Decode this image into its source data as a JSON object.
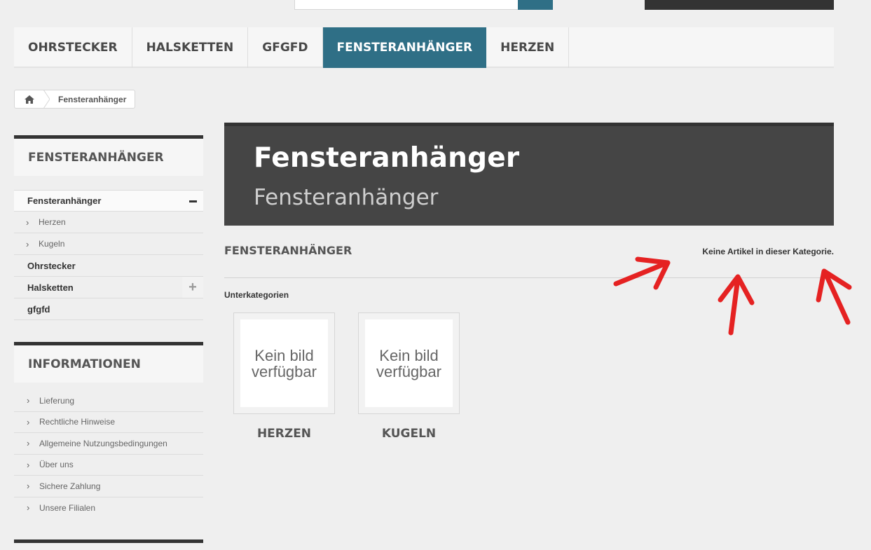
{
  "menu": {
    "items": [
      {
        "label": "OHRSTECKER"
      },
      {
        "label": "HALSKETTEN"
      },
      {
        "label": "GFGFD"
      },
      {
        "label": "FENSTERANHÄNGER"
      },
      {
        "label": "HERZEN"
      }
    ],
    "active_index": 3
  },
  "breadcrumb": {
    "home_icon": "home-icon",
    "current": "Fensteranhänger"
  },
  "sidebar": {
    "categories_title": "FENSTERANHÄNGER",
    "categories": [
      {
        "label": "Fensteranhänger",
        "toggle": "minus"
      },
      {
        "label": "Herzen"
      },
      {
        "label": "Kugeln"
      },
      {
        "label": "Ohrstecker"
      },
      {
        "label": "Halsketten",
        "toggle": "plus"
      },
      {
        "label": "gfgfd"
      }
    ],
    "info_title": "INFORMATIONEN",
    "info_items": [
      {
        "label": "Lieferung"
      },
      {
        "label": "Rechtliche Hinweise"
      },
      {
        "label": "Allgemeine Nutzungsbedingungen"
      },
      {
        "label": "Über uns"
      },
      {
        "label": "Sichere Zahlung"
      },
      {
        "label": "Unsere Filialen"
      }
    ]
  },
  "header": {
    "title": "Fensteranhänger",
    "subtitle": "Fensteranhänger"
  },
  "content": {
    "heading": "FENSTERANHÄNGER",
    "product_count": "Keine Artikel in dieser Kategorie.",
    "subcategories_label": "Unterkategorien",
    "subcategories": [
      {
        "image_text_1": "Kein bild",
        "image_text_2": "verfügbar",
        "name": "HERZEN"
      },
      {
        "image_text_1": "Kein bild",
        "image_text_2": "verfügbar",
        "name": "KUGELN"
      }
    ]
  },
  "colors": {
    "accent": "#2f6f86",
    "dark": "#454545",
    "annotation": "#e52222"
  }
}
